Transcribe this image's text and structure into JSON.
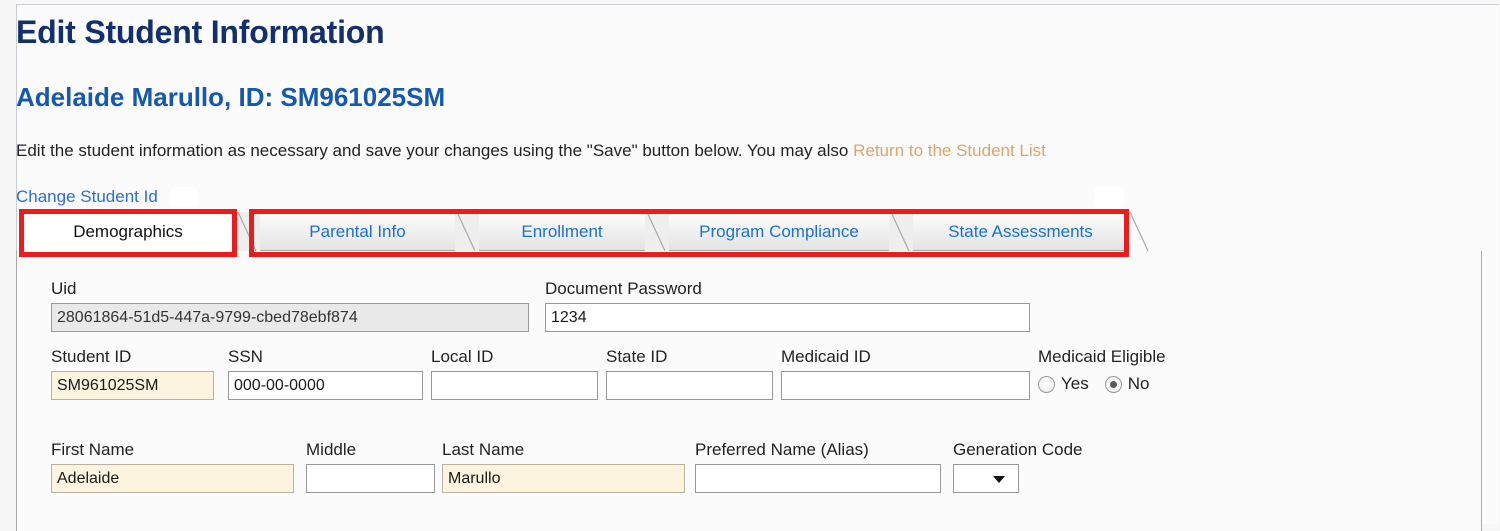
{
  "page": {
    "title": "Edit Student Information",
    "student_heading": "Adelaide Marullo, ID: SM961025SM",
    "intro_prefix": "Edit the student information as necessary and save your changes using the \"Save\" button below. You may also ",
    "intro_link": "Return to the Student List",
    "change_student_id_link": "Change Student Id"
  },
  "colors": {
    "title_blue": "#12306e",
    "heading_blue": "#1558b0",
    "link_blue": "#2a6ed6",
    "return_link_orange": "#e0a36a",
    "annotation_red": "#ec1c1c",
    "required_field_cream": "#fdf4df",
    "disabled_field_grey": "#e9e9e9"
  },
  "tabs": [
    {
      "label": "Demographics",
      "active": true
    },
    {
      "label": "Parental Info",
      "active": false
    },
    {
      "label": "Enrollment",
      "active": false
    },
    {
      "label": "Program Compliance",
      "active": false
    },
    {
      "label": "State Assessments",
      "active": false
    }
  ],
  "form": {
    "uid": {
      "label": "Uid",
      "value": "28061864-51d5-447a-9799-cbed78ebf874",
      "placeholder": ""
    },
    "document_password": {
      "label": "Document Password",
      "value": "1234",
      "placeholder": ""
    },
    "student_id": {
      "label": "Student ID",
      "value": "SM961025SM",
      "placeholder": ""
    },
    "ssn": {
      "label": "SSN",
      "value": "000-00-0000",
      "placeholder": ""
    },
    "local_id": {
      "label": "Local ID",
      "value": "",
      "placeholder": ""
    },
    "state_id": {
      "label": "State ID",
      "value": "",
      "placeholder": ""
    },
    "medicaid_id": {
      "label": "Medicaid ID",
      "value": "",
      "placeholder": ""
    },
    "medicaid_eligible": {
      "label": "Medicaid Eligible",
      "yes_label": "Yes",
      "no_label": "No",
      "selected": "No"
    },
    "first_name": {
      "label": "First Name",
      "value": "Adelaide",
      "placeholder": ""
    },
    "middle": {
      "label": "Middle",
      "value": "",
      "placeholder": ""
    },
    "last_name": {
      "label": "Last Name",
      "value": "Marullo",
      "placeholder": ""
    },
    "preferred_name": {
      "label": "Preferred Name (Alias)",
      "value": "",
      "placeholder": ""
    },
    "generation_code": {
      "label": "Generation Code",
      "value": "",
      "placeholder": ""
    }
  }
}
